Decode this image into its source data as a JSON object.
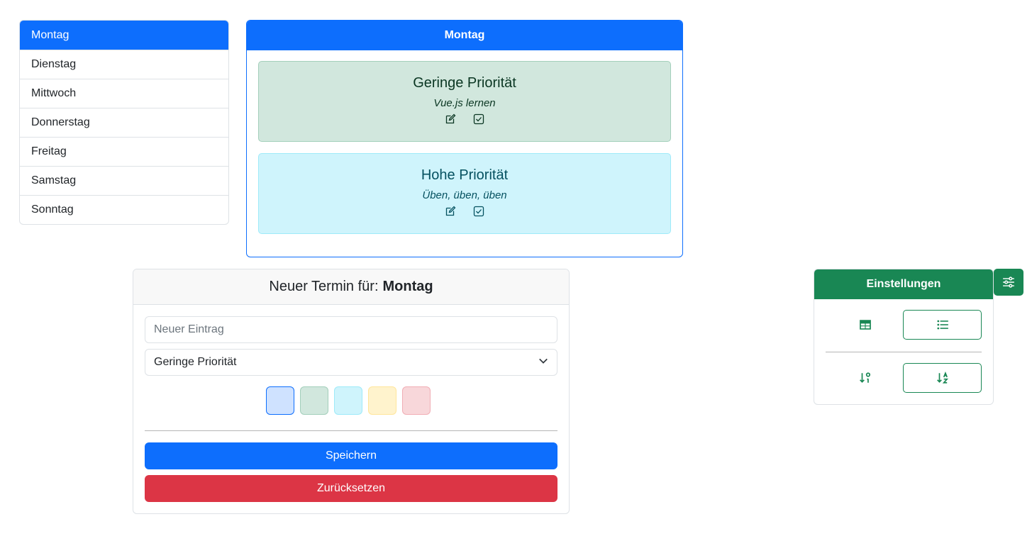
{
  "days": [
    {
      "label": "Montag",
      "active": true
    },
    {
      "label": "Dienstag",
      "active": false
    },
    {
      "label": "Mittwoch",
      "active": false
    },
    {
      "label": "Donnerstag",
      "active": false
    },
    {
      "label": "Freitag",
      "active": false
    },
    {
      "label": "Samstag",
      "active": false
    },
    {
      "label": "Sonntag",
      "active": false
    }
  ],
  "day_card": {
    "title": "Montag",
    "tasks": [
      {
        "priority": "Geringe Priorität",
        "text": "Vue.js lernen",
        "icons": [
          "edit-icon",
          "check-square-icon"
        ]
      },
      {
        "priority": "Hohe Priorität",
        "text": "Üben, üben, üben",
        "icons": [
          "edit-icon",
          "check-square-icon"
        ]
      }
    ]
  },
  "form": {
    "header_prefix": "Neuer Termin für:",
    "header_day": "Montag",
    "entry_placeholder": "Neuer Eintrag",
    "priority_selected": "Geringe Priorität",
    "colors": [
      "#cfe2ff",
      "#d1e7dd",
      "#cff4fc",
      "#fff3cd",
      "#f8d7da"
    ],
    "selected_color": "#cfe2ff",
    "save_label": "Speichern",
    "reset_label": "Zurücksetzen"
  },
  "settings": {
    "title": "Einstellungen",
    "view_options": [
      "table-icon",
      "list-icon"
    ],
    "sort_options": [
      "sort-numeric-down-icon",
      "sort-alpha-down-icon"
    ],
    "toggle_icon": "sliders-icon",
    "accent_color": "#198754"
  },
  "colors": {
    "primary": "#0d6efd",
    "success": "#198754",
    "danger": "#dc3545"
  }
}
